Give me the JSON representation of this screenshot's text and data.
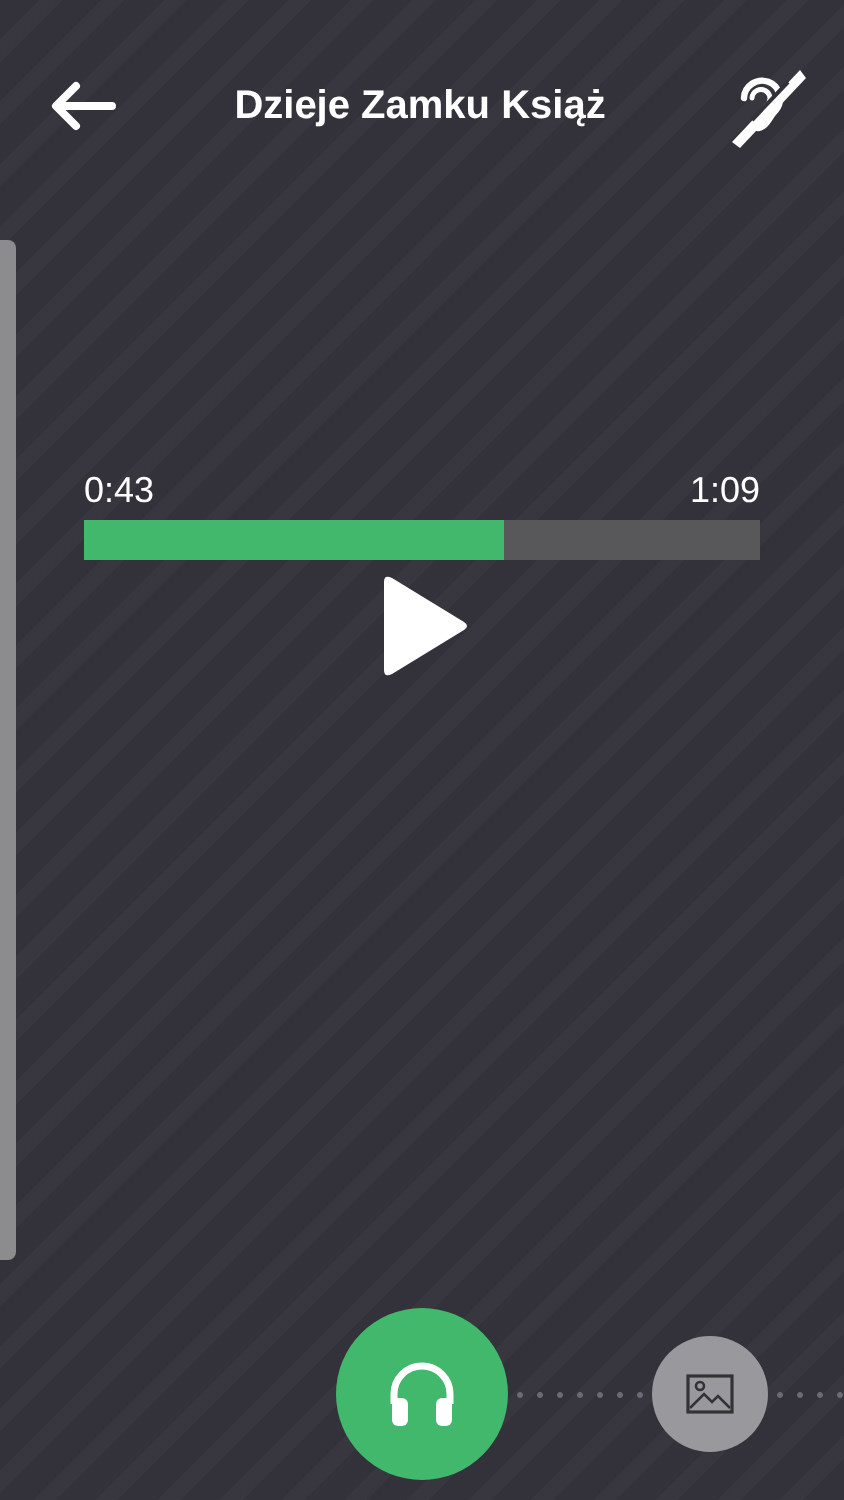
{
  "header": {
    "title": "Dzieje Zamku Książ"
  },
  "player": {
    "elapsed": "0:43",
    "duration": "1:09",
    "level": 0.62,
    "playing": false
  },
  "modes": [
    {
      "kind": "audio",
      "selected": true
    },
    {
      "kind": "gallery",
      "selected": false
    }
  ]
}
